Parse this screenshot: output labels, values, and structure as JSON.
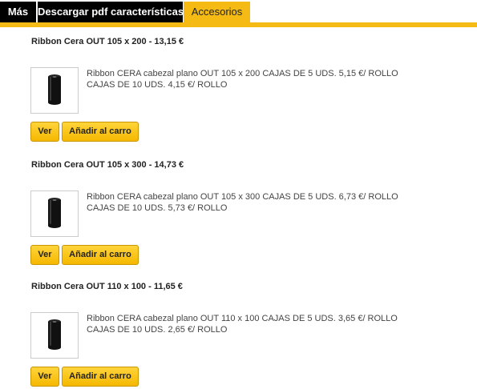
{
  "tabs": [
    {
      "label": "Más"
    },
    {
      "label": "Descargar pdf características"
    },
    {
      "label": "Accesorios"
    }
  ],
  "colors": {
    "accent": "#f5bb14",
    "tab_dark": "#000000"
  },
  "products": [
    {
      "title": "Ribbon Cera OUT 105 x 200 - 13,15 €",
      "description": "Ribbon CERA cabezal plano OUT 105 x 200 CAJAS DE 5 UDS. 5,15 €/ ROLLO CAJAS DE 10 UDS. 4,15 €/ ROLLO",
      "image_icon": "ribbon-roll-icon",
      "view_label": "Ver",
      "add_label": "Añadir al carro"
    },
    {
      "title": "Ribbon Cera OUT 105 x 300 - 14,73 €",
      "description": "Ribbon CERA cabezal plano OUT 105 x 300 CAJAS DE 5 UDS. 6,73 €/ ROLLO CAJAS DE 10 UDS. 5,73 €/ ROLLO",
      "image_icon": "ribbon-roll-icon",
      "view_label": "Ver",
      "add_label": "Añadir al carro"
    },
    {
      "title": "Ribbon Cera OUT 110 x 100 - 11,65 €",
      "description": "Ribbon CERA cabezal plano OUT 110 x 100 CAJAS DE 5 UDS. 3,65 €/ ROLLO CAJAS DE 10 UDS. 2,65 €/ ROLLO",
      "image_icon": "ribbon-roll-icon",
      "view_label": "Ver",
      "add_label": "Añadir al carro"
    }
  ]
}
